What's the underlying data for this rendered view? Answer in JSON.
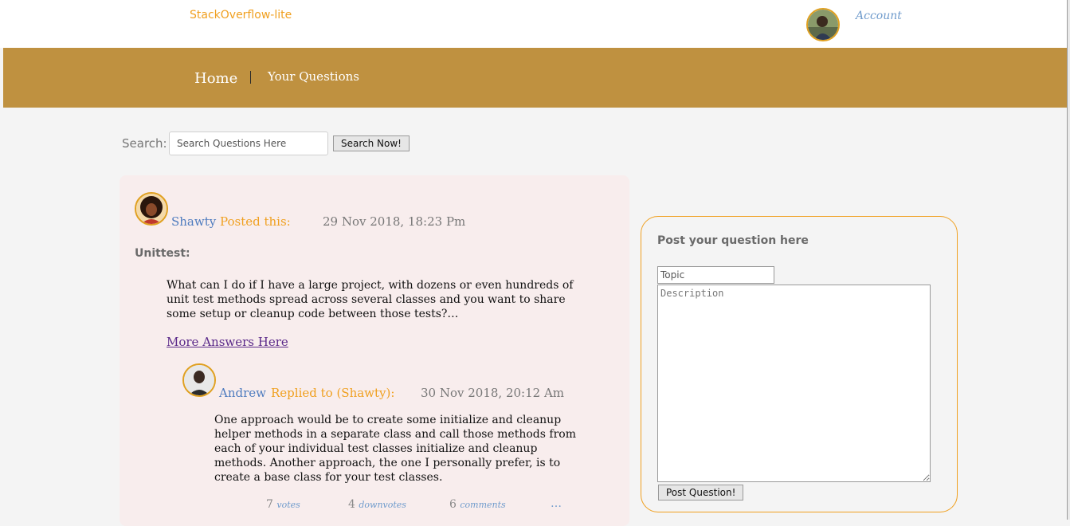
{
  "header": {
    "brand": "StackOverflow-lite",
    "account_label": "Account"
  },
  "nav": {
    "home": "Home",
    "your_questions": "Your Questions"
  },
  "search": {
    "label": "Search:",
    "placeholder": "Search Questions Here",
    "button": "Search Now!"
  },
  "question": {
    "author": "Shawty",
    "action": "Posted this:",
    "date": "29 Nov 2018, 18:23 Pm",
    "topic": "Unittest:",
    "body": "What can I do if I have a large project, with dozens or even hundreds of unit test methods spread across several classes and you want to share some setup or cleanup code between those tests?…",
    "more_link": "More Answers Here"
  },
  "reply": {
    "author": "Andrew",
    "action": "Replied to (Shawty):",
    "date": "30 Nov 2018, 20:12 Am",
    "body": "One approach would be to create some initialize and cleanup helper methods in a separate class and call those methods from each of your individual test classes initialize and cleanup methods. Another approach, the one I personally prefer, is to create a base class for your test classes.",
    "stats": {
      "votes_count": "7",
      "votes_label": "votes",
      "downvotes_count": "4",
      "downvotes_label": "downvotes",
      "comments_count": "6",
      "comments_label": "comments",
      "more": "…"
    }
  },
  "post_form": {
    "title": "Post your question here",
    "topic_placeholder": "Topic",
    "description_placeholder": "Description",
    "button": "Post Question!"
  },
  "colors": {
    "nav_bg": "#bf9140",
    "accent_orange": "#f0a020",
    "author_blue": "#4f7cbf",
    "card_bg": "#f8eded"
  }
}
